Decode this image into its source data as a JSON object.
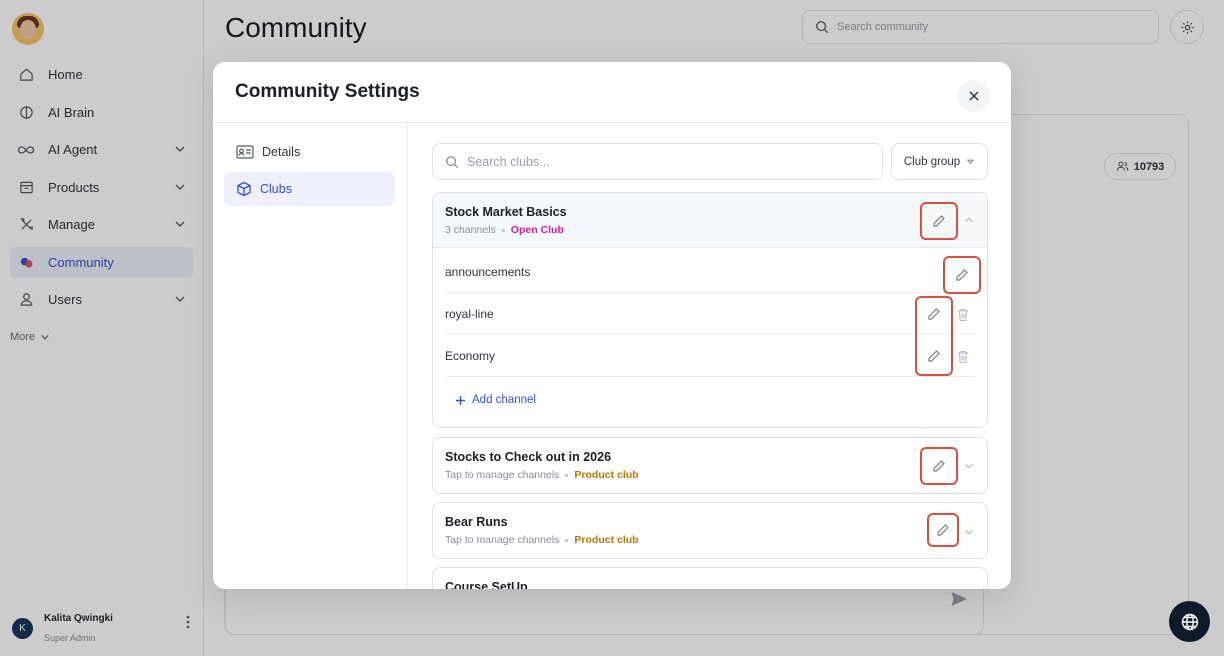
{
  "sidebar": {
    "items": [
      {
        "label": "Home",
        "icon": "home-icon"
      },
      {
        "label": "AI Brain",
        "icon": "brain-icon"
      },
      {
        "label": "AI Agent",
        "icon": "infinity-icon"
      },
      {
        "label": "Products",
        "icon": "box-icon"
      },
      {
        "label": "Manage",
        "icon": "tools-icon"
      },
      {
        "label": "Community",
        "icon": "community-icon"
      },
      {
        "label": "Users",
        "icon": "user-icon"
      }
    ],
    "more_label": "More",
    "user": {
      "initial": "K",
      "name": "Kalita Qwingki",
      "role": "Super Admin"
    }
  },
  "header": {
    "title": "Community",
    "search_placeholder": "Search community"
  },
  "background": {
    "member_count": "10793"
  },
  "modal": {
    "title": "Community Settings",
    "nav": [
      {
        "label": "Details"
      },
      {
        "label": "Clubs"
      }
    ],
    "search_placeholder": "Search clubs...",
    "group_label": "Club group",
    "add_channel_label": "Add channel",
    "clubs": [
      {
        "name": "Stock Market Basics",
        "meta": "3 channels",
        "tag": "Open Club",
        "channels": [
          "announcements",
          "royal-line",
          "Economy"
        ]
      },
      {
        "name": "Stocks to Check out in 2026",
        "meta": "Tap to manage channels",
        "tag": "Product club"
      },
      {
        "name": "Bear Runs",
        "meta": "Tap to manage channels",
        "tag": "Product club"
      },
      {
        "name": "Course SetUp"
      }
    ]
  },
  "colors": {
    "accent": "#3b4bd8",
    "highlight": "#d9503f",
    "open_tag": "#d21f9b",
    "product_tag": "#b87503"
  }
}
